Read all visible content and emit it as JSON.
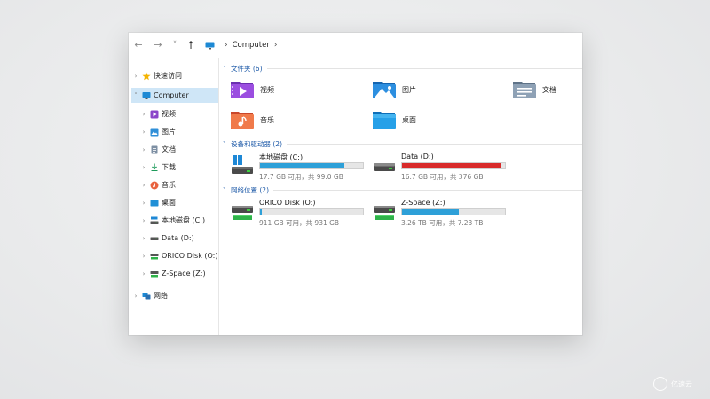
{
  "address_bar": {
    "separator": "›",
    "path": "Computer",
    "trail_chevron": "›"
  },
  "toolbar": {
    "back_glyph": "←",
    "forward_glyph": "→",
    "recent_glyph": "˅",
    "up_glyph": "↑"
  },
  "sidebar": {
    "items": [
      {
        "label": "快速访问",
        "icon": "star-icon",
        "expanded": false
      },
      {
        "label": "Computer",
        "icon": "computer-icon",
        "expanded": true,
        "selected": true
      },
      {
        "label": "视频",
        "icon": "video-icon"
      },
      {
        "label": "图片",
        "icon": "picture-icon"
      },
      {
        "label": "文档",
        "icon": "document-icon"
      },
      {
        "label": "下载",
        "icon": "download-icon"
      },
      {
        "label": "音乐",
        "icon": "music-icon"
      },
      {
        "label": "桌面",
        "icon": "desktop-icon"
      },
      {
        "label": "本地磁盘 (C:)",
        "icon": "windows-drive-icon"
      },
      {
        "label": "Data (D:)",
        "icon": "drive-icon"
      },
      {
        "label": "ORICO Disk (O:)",
        "icon": "network-drive-icon"
      },
      {
        "label": "Z-Space (Z:)",
        "icon": "network-drive-icon"
      },
      {
        "label": "网络",
        "icon": "network-icon",
        "expanded": false
      }
    ]
  },
  "groups": {
    "folders": {
      "title": "文件夹 (6)",
      "items": [
        {
          "label": "视频",
          "icon": "video-folder-icon"
        },
        {
          "label": "图片",
          "icon": "pictures-folder-icon"
        },
        {
          "label": "文档",
          "icon": "documents-folder-icon"
        },
        {
          "label": "音乐",
          "icon": "music-folder-icon"
        },
        {
          "label": "桌面",
          "icon": "desktop-folder-icon"
        }
      ]
    },
    "devices": {
      "title": "设备和驱动器 (2)",
      "items": [
        {
          "label": "本地磁盘 (C:)",
          "free_text": "17.7 GB 可用，共 99.0 GB",
          "used_fraction": 0.82,
          "bar_color": "#2ea0d8",
          "icon": "windows-drive-icon"
        },
        {
          "label": "Data (D:)",
          "free_text": "16.7 GB 可用，共 376 GB",
          "used_fraction": 0.96,
          "bar_color": "#d82b2b",
          "icon": "drive-icon"
        }
      ]
    },
    "network": {
      "title": "网络位置 (2)",
      "items": [
        {
          "label": "ORICO Disk (O:)",
          "free_text": "911 GB 可用，共 931 GB",
          "used_fraction": 0.02,
          "bar_color": "#2ea0d8",
          "icon": "network-drive-icon"
        },
        {
          "label": "Z-Space (Z:)",
          "free_text": "3.26 TB 可用，共 7.23 TB",
          "used_fraction": 0.55,
          "bar_color": "#2ea0d8",
          "icon": "network-drive-icon"
        }
      ]
    }
  },
  "watermark": {
    "text": "亿速云"
  }
}
